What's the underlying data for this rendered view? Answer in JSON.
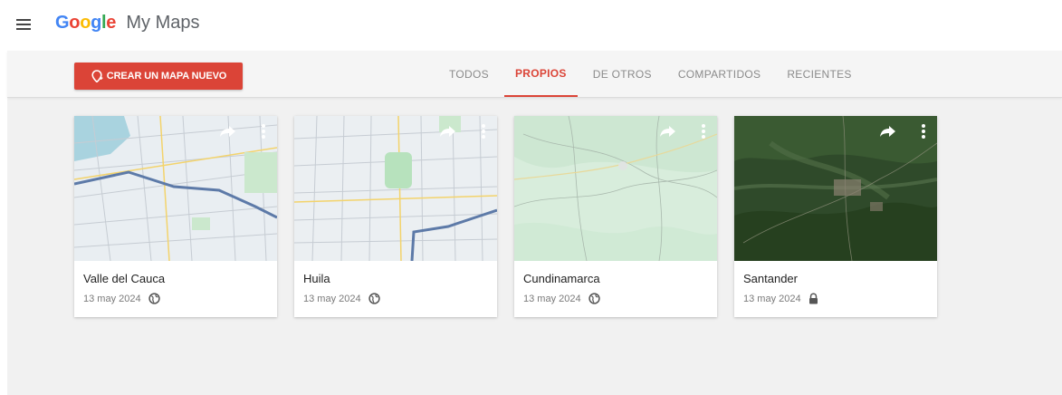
{
  "app": {
    "logo_letters": [
      {
        "ch": "G",
        "color": "#4285F4"
      },
      {
        "ch": "o",
        "color": "#EA4335"
      },
      {
        "ch": "o",
        "color": "#FBBC05"
      },
      {
        "ch": "g",
        "color": "#4285F4"
      },
      {
        "ch": "l",
        "color": "#34A853"
      },
      {
        "ch": "e",
        "color": "#EA4335"
      }
    ],
    "product": "My Maps"
  },
  "toolbar": {
    "create_label": "CREAR UN MAPA NUEVO",
    "accent": "#db4437"
  },
  "tabs": [
    {
      "label": "TODOS",
      "active": false
    },
    {
      "label": "PROPIOS",
      "active": true
    },
    {
      "label": "DE OTROS",
      "active": false
    },
    {
      "label": "COMPARTIDOS",
      "active": false
    },
    {
      "label": "RECIENTES",
      "active": false
    }
  ],
  "maps": [
    {
      "title": "Valle del Cauca",
      "date": "13 may 2024",
      "visibility_icon": "globe-icon",
      "thumbnail": "street-map"
    },
    {
      "title": "Huila",
      "date": "13 may 2024",
      "visibility_icon": "globe-icon",
      "thumbnail": "street-map"
    },
    {
      "title": "Cundinamarca",
      "date": "13 may 2024",
      "visibility_icon": "globe-icon",
      "thumbnail": "terrain-map"
    },
    {
      "title": "Santander",
      "date": "13 may 2024",
      "visibility_icon": "lock-icon",
      "thumbnail": "satellite-map"
    }
  ],
  "card_icons": {
    "share": "share-icon",
    "more": "more-vert-icon"
  }
}
